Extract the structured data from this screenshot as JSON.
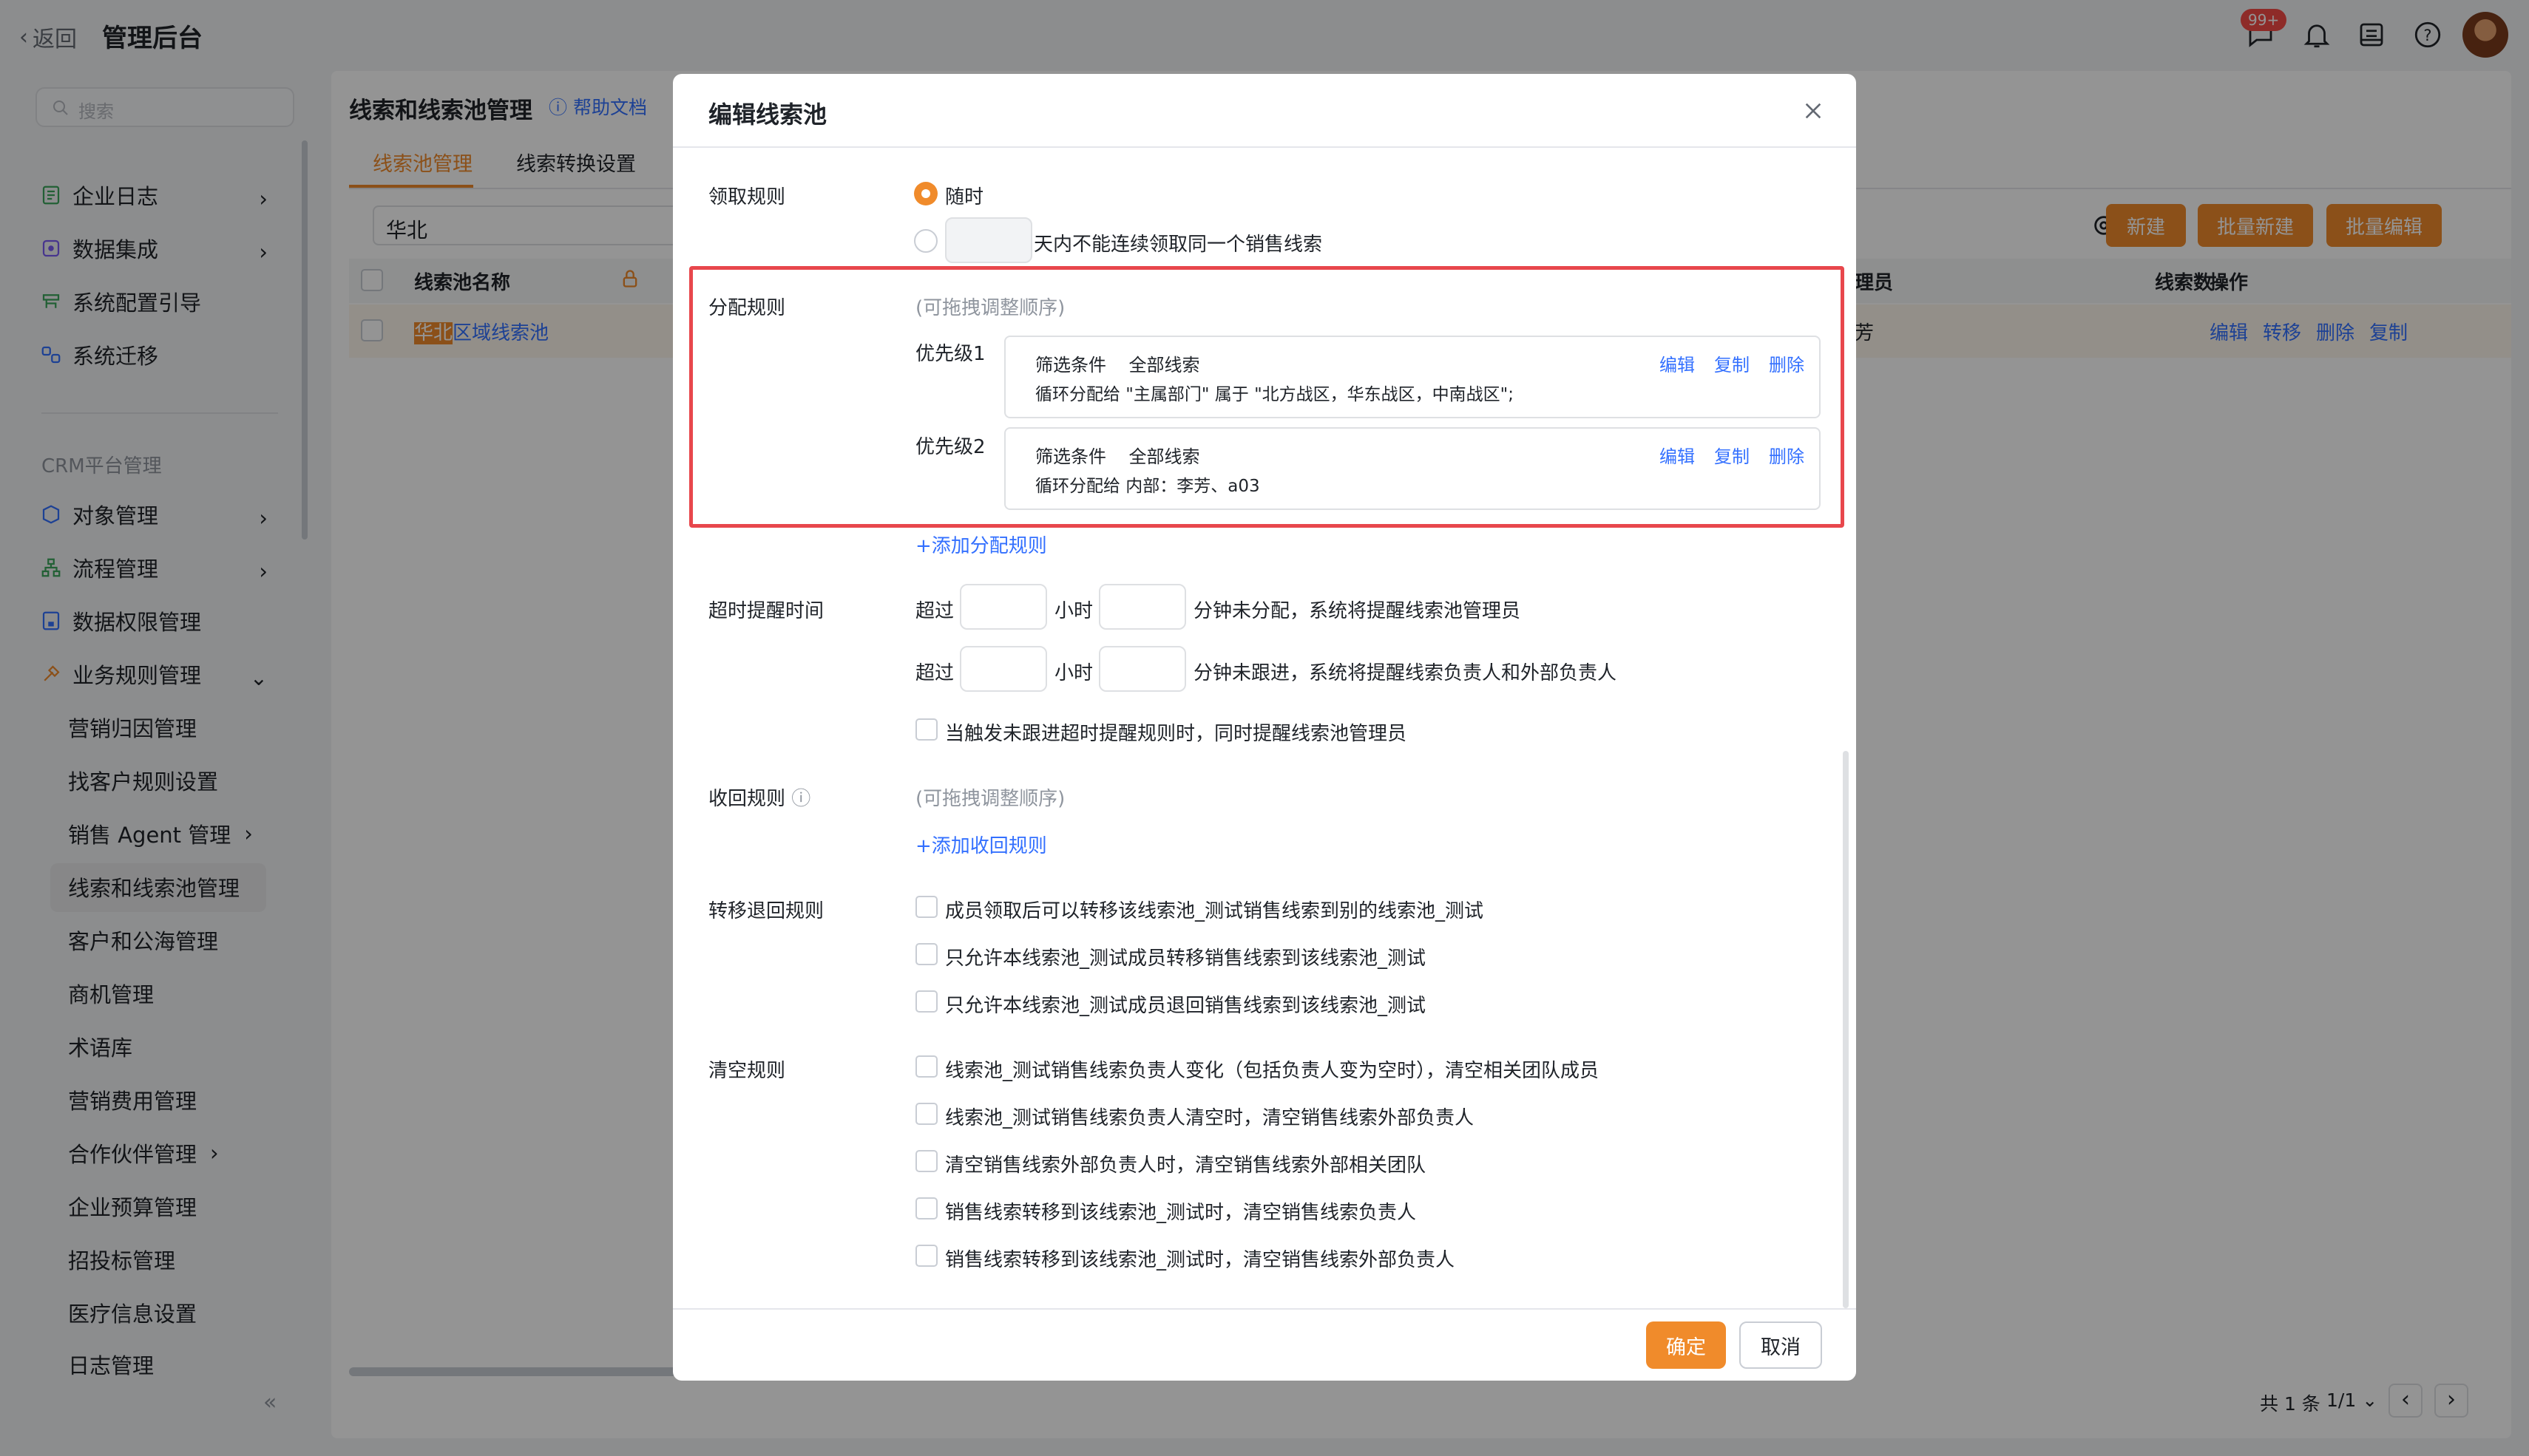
{
  "topbar": {
    "back_label": "返回",
    "app_title": "管理后台",
    "notification_badge": "99+",
    "icons": [
      "message-icon",
      "bell-icon",
      "inbox-icon",
      "help-icon",
      "avatar"
    ]
  },
  "sidebar": {
    "search_placeholder": "搜索",
    "items_top": [
      {
        "label": "企业日志",
        "icon": "log-icon",
        "has_children": true
      },
      {
        "label": "数据集成",
        "icon": "integration-icon",
        "has_children": true
      },
      {
        "label": "系统配置引导",
        "icon": "config-guide-icon",
        "has_children": false
      },
      {
        "label": "系统迁移",
        "icon": "migration-icon",
        "has_children": false
      }
    ],
    "section_title": "CRM平台管理",
    "items_crm": [
      {
        "label": "对象管理",
        "icon": "object-icon",
        "has_children": true
      },
      {
        "label": "流程管理",
        "icon": "flow-icon",
        "has_children": true
      },
      {
        "label": "数据权限管理",
        "icon": "permission-icon",
        "has_children": false
      },
      {
        "label": "业务规则管理",
        "icon": "rule-icon",
        "has_children": true,
        "expanded": true
      }
    ],
    "sub_items": [
      {
        "label": "营销归因管理"
      },
      {
        "label": "找客户规则设置"
      },
      {
        "label": "销售 Agent 管理",
        "has_children": true
      },
      {
        "label": "线索和线索池管理",
        "active": true
      },
      {
        "label": "客户和公海管理"
      },
      {
        "label": "商机管理"
      },
      {
        "label": "术语库"
      },
      {
        "label": "营销费用管理"
      },
      {
        "label": "合作伙伴管理",
        "has_children": true
      },
      {
        "label": "企业预算管理"
      },
      {
        "label": "招投标管理"
      },
      {
        "label": "医疗信息设置"
      },
      {
        "label": "日志管理"
      }
    ],
    "collapse_icon": "«"
  },
  "page": {
    "title": "线索和线索池管理",
    "help_link": "帮助文档",
    "tabs": [
      {
        "label": "线索池管理",
        "active": true
      },
      {
        "label": "线索转换设置",
        "active": false
      }
    ],
    "filter_value": "华北",
    "buttons": {
      "new": "新建",
      "batch_new": "批量新建",
      "batch_edit": "批量编辑"
    },
    "table": {
      "headers": {
        "name": "线索池名称",
        "member": "理员",
        "clue": "线索数",
        "ops": "操作"
      },
      "row": {
        "name_highlight": "华北",
        "name_rest": "区域线索池",
        "member_frag": "芳",
        "ops": [
          "编辑",
          "转移",
          "删除",
          "复制"
        ]
      }
    },
    "pagination": {
      "total": "共 1 条",
      "page": "1/1"
    }
  },
  "modal": {
    "title": "编辑线索池",
    "claim_rule": {
      "label": "领取规则",
      "option_anytime": "随时",
      "option_days_suffix": "天内不能连续领取同一个销售线索"
    },
    "assign_rule": {
      "label": "分配规则",
      "hint": "(可拖拽调整顺序)",
      "priorities": [
        {
          "label": "优先级1",
          "filter_label": "筛选条件",
          "filter_value": "全部线索",
          "assign_text": "循环分配给 \"主属部门\" 属于 \"北方战区，华东战区，中南战区\";",
          "actions": [
            "编辑",
            "复制",
            "删除"
          ]
        },
        {
          "label": "优先级2",
          "filter_label": "筛选条件",
          "filter_value": "全部线索",
          "assign_text": "循环分配给 内部：李芳、a03",
          "actions": [
            "编辑",
            "复制",
            "删除"
          ]
        }
      ],
      "add_link": "+添加分配规则"
    },
    "timeout": {
      "label": "超时提醒时间",
      "over": "超过",
      "hour": "小时",
      "line1_suffix": "分钟未分配，系统将提醒线索池管理员",
      "line2_suffix": "分钟未跟进，系统将提醒线索负责人和外部负责人",
      "checkbox": "当触发未跟进超时提醒规则时，同时提醒线索池管理员"
    },
    "recycle": {
      "label": "收回规则",
      "hint": "(可拖拽调整顺序)",
      "add_link": "+添加收回规则"
    },
    "transfer": {
      "label": "转移退回规则",
      "options": [
        "成员领取后可以转移该线索池_测试销售线索到别的线索池_测试",
        "只允许本线索池_测试成员转移销售线索到该线索池_测试",
        "只允许本线索池_测试成员退回销售线索到该线索池_测试"
      ]
    },
    "clear": {
      "label": "清空规则",
      "options": [
        "线索池_测试销售线索负责人变化（包括负责人变为空时），清空相关团队成员",
        "线索池_测试销售线索负责人清空时，清空销售线索外部负责人",
        "清空销售线索外部负责人时，清空销售线索外部相关团队",
        "销售线索转移到该线索池_测试时，清空销售线索负责人",
        "销售线索转移到该线索池_测试时，清空销售线索外部负责人"
      ]
    },
    "footer": {
      "ok": "确定",
      "cancel": "取消"
    }
  }
}
